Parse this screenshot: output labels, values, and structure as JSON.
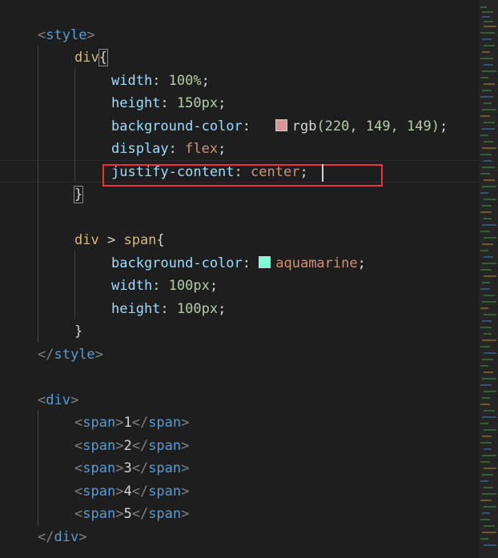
{
  "code": {
    "style_open": "style",
    "div_selector": "div",
    "width_prop": "width",
    "width_val": "100%",
    "height_prop": "height",
    "height_val": "150px",
    "bg_prop": "background-color",
    "bg_rgb": "rgb",
    "bg_args": "(220, 149, 149)",
    "bg_swatch_color": "#dc9595",
    "display_prop": "display",
    "display_val": "flex",
    "justify_prop": "justify-content",
    "justify_val": "center",
    "span_selector_div": "div",
    "span_selector_gt": ">",
    "span_selector_span": "span",
    "span_bg_prop": "background-color",
    "span_bg_val": "aquamarine",
    "span_bg_swatch_color": "#7fffd4",
    "span_width_prop": "width",
    "span_width_val": "100px",
    "span_height_prop": "height",
    "span_height_val": "100px",
    "style_close": "style",
    "div_open": "div",
    "spans": [
      {
        "tag": "span",
        "text": "1"
      },
      {
        "tag": "span",
        "text": "2"
      },
      {
        "tag": "span",
        "text": "3"
      },
      {
        "tag": "span",
        "text": "4"
      },
      {
        "tag": "span",
        "text": "5"
      }
    ],
    "div_close": "div"
  }
}
